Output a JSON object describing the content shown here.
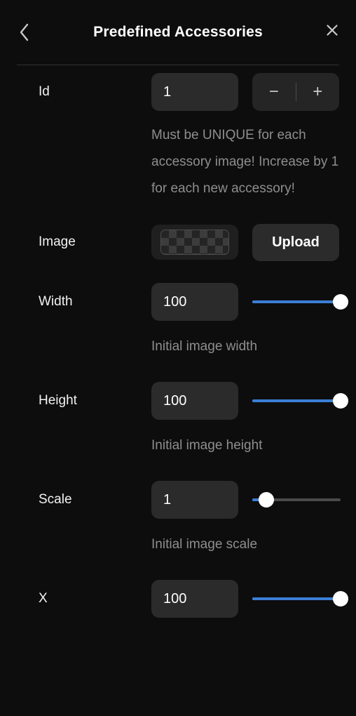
{
  "header": {
    "title": "Predefined Accessories",
    "back_icon": "chevron-left-icon",
    "close_icon": "close-icon"
  },
  "accent_color": "#3b7fd6",
  "rows": {
    "id": {
      "label": "Id",
      "value": "1",
      "minus_label": "−",
      "plus_label": "+",
      "help": "Must be UNIQUE for each accessory image! Increase by 1 for each new accessory!"
    },
    "image": {
      "label": "Image",
      "preview_icon": "transparent-checkerboard-thumbnail",
      "upload_label": "Upload"
    },
    "width": {
      "label": "Width",
      "value": "100",
      "slider_percent": 100,
      "help": "Initial image width"
    },
    "height": {
      "label": "Height",
      "value": "100",
      "slider_percent": 100,
      "help": "Initial image height"
    },
    "scale": {
      "label": "Scale",
      "value": "1",
      "slider_percent": 16,
      "help": "Initial image scale"
    },
    "x": {
      "label": "X",
      "value": "100",
      "slider_percent": 100
    }
  }
}
